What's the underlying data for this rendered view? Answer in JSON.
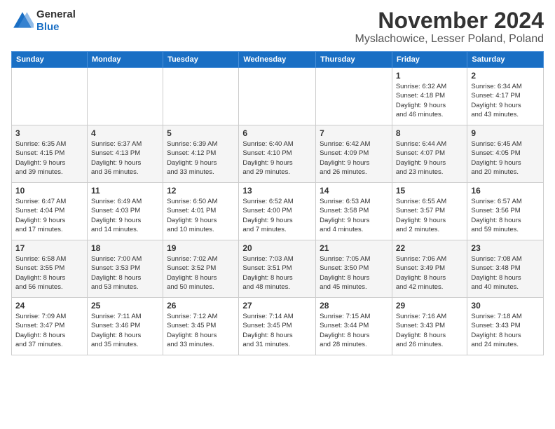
{
  "logo": {
    "general": "General",
    "blue": "Blue"
  },
  "header": {
    "month": "November 2024",
    "location": "Myslachowice, Lesser Poland, Poland"
  },
  "weekdays": [
    "Sunday",
    "Monday",
    "Tuesday",
    "Wednesday",
    "Thursday",
    "Friday",
    "Saturday"
  ],
  "rows": [
    [
      {
        "day": "",
        "info": ""
      },
      {
        "day": "",
        "info": ""
      },
      {
        "day": "",
        "info": ""
      },
      {
        "day": "",
        "info": ""
      },
      {
        "day": "",
        "info": ""
      },
      {
        "day": "1",
        "info": "Sunrise: 6:32 AM\nSunset: 4:18 PM\nDaylight: 9 hours\nand 46 minutes."
      },
      {
        "day": "2",
        "info": "Sunrise: 6:34 AM\nSunset: 4:17 PM\nDaylight: 9 hours\nand 43 minutes."
      }
    ],
    [
      {
        "day": "3",
        "info": "Sunrise: 6:35 AM\nSunset: 4:15 PM\nDaylight: 9 hours\nand 39 minutes."
      },
      {
        "day": "4",
        "info": "Sunrise: 6:37 AM\nSunset: 4:13 PM\nDaylight: 9 hours\nand 36 minutes."
      },
      {
        "day": "5",
        "info": "Sunrise: 6:39 AM\nSunset: 4:12 PM\nDaylight: 9 hours\nand 33 minutes."
      },
      {
        "day": "6",
        "info": "Sunrise: 6:40 AM\nSunset: 4:10 PM\nDaylight: 9 hours\nand 29 minutes."
      },
      {
        "day": "7",
        "info": "Sunrise: 6:42 AM\nSunset: 4:09 PM\nDaylight: 9 hours\nand 26 minutes."
      },
      {
        "day": "8",
        "info": "Sunrise: 6:44 AM\nSunset: 4:07 PM\nDaylight: 9 hours\nand 23 minutes."
      },
      {
        "day": "9",
        "info": "Sunrise: 6:45 AM\nSunset: 4:05 PM\nDaylight: 9 hours\nand 20 minutes."
      }
    ],
    [
      {
        "day": "10",
        "info": "Sunrise: 6:47 AM\nSunset: 4:04 PM\nDaylight: 9 hours\nand 17 minutes."
      },
      {
        "day": "11",
        "info": "Sunrise: 6:49 AM\nSunset: 4:03 PM\nDaylight: 9 hours\nand 14 minutes."
      },
      {
        "day": "12",
        "info": "Sunrise: 6:50 AM\nSunset: 4:01 PM\nDaylight: 9 hours\nand 10 minutes."
      },
      {
        "day": "13",
        "info": "Sunrise: 6:52 AM\nSunset: 4:00 PM\nDaylight: 9 hours\nand 7 minutes."
      },
      {
        "day": "14",
        "info": "Sunrise: 6:53 AM\nSunset: 3:58 PM\nDaylight: 9 hours\nand 4 minutes."
      },
      {
        "day": "15",
        "info": "Sunrise: 6:55 AM\nSunset: 3:57 PM\nDaylight: 9 hours\nand 2 minutes."
      },
      {
        "day": "16",
        "info": "Sunrise: 6:57 AM\nSunset: 3:56 PM\nDaylight: 8 hours\nand 59 minutes."
      }
    ],
    [
      {
        "day": "17",
        "info": "Sunrise: 6:58 AM\nSunset: 3:55 PM\nDaylight: 8 hours\nand 56 minutes."
      },
      {
        "day": "18",
        "info": "Sunrise: 7:00 AM\nSunset: 3:53 PM\nDaylight: 8 hours\nand 53 minutes."
      },
      {
        "day": "19",
        "info": "Sunrise: 7:02 AM\nSunset: 3:52 PM\nDaylight: 8 hours\nand 50 minutes."
      },
      {
        "day": "20",
        "info": "Sunrise: 7:03 AM\nSunset: 3:51 PM\nDaylight: 8 hours\nand 48 minutes."
      },
      {
        "day": "21",
        "info": "Sunrise: 7:05 AM\nSunset: 3:50 PM\nDaylight: 8 hours\nand 45 minutes."
      },
      {
        "day": "22",
        "info": "Sunrise: 7:06 AM\nSunset: 3:49 PM\nDaylight: 8 hours\nand 42 minutes."
      },
      {
        "day": "23",
        "info": "Sunrise: 7:08 AM\nSunset: 3:48 PM\nDaylight: 8 hours\nand 40 minutes."
      }
    ],
    [
      {
        "day": "24",
        "info": "Sunrise: 7:09 AM\nSunset: 3:47 PM\nDaylight: 8 hours\nand 37 minutes."
      },
      {
        "day": "25",
        "info": "Sunrise: 7:11 AM\nSunset: 3:46 PM\nDaylight: 8 hours\nand 35 minutes."
      },
      {
        "day": "26",
        "info": "Sunrise: 7:12 AM\nSunset: 3:45 PM\nDaylight: 8 hours\nand 33 minutes."
      },
      {
        "day": "27",
        "info": "Sunrise: 7:14 AM\nSunset: 3:45 PM\nDaylight: 8 hours\nand 31 minutes."
      },
      {
        "day": "28",
        "info": "Sunrise: 7:15 AM\nSunset: 3:44 PM\nDaylight: 8 hours\nand 28 minutes."
      },
      {
        "day": "29",
        "info": "Sunrise: 7:16 AM\nSunset: 3:43 PM\nDaylight: 8 hours\nand 26 minutes."
      },
      {
        "day": "30",
        "info": "Sunrise: 7:18 AM\nSunset: 3:43 PM\nDaylight: 8 hours\nand 24 minutes."
      }
    ]
  ]
}
